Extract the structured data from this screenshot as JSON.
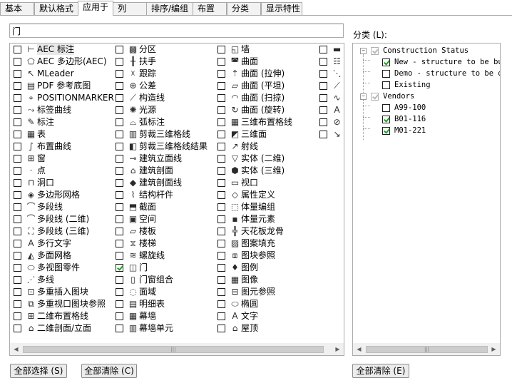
{
  "tabs": [
    "基本",
    "默认格式",
    "应用于",
    "列",
    "排序/编组",
    "布置",
    "分类",
    "显示特性"
  ],
  "active_tab": "应用于",
  "filter": {
    "value": "门"
  },
  "columns": [
    [
      {
        "label": "AEC 标注",
        "icon": "aec-dimension-icon",
        "checked": false,
        "selected": true
      },
      {
        "label": "AEC 多边形(AEC)",
        "icon": "aec-polygon-icon",
        "checked": false
      },
      {
        "label": "MLeader",
        "icon": "mleader-icon",
        "checked": false
      },
      {
        "label": "PDF 参考底图",
        "icon": "pdf-underlay-icon",
        "checked": false
      },
      {
        "label": "POSITIONMARKER",
        "icon": "position-marker-icon",
        "checked": false
      },
      {
        "label": "标签曲线",
        "icon": "tag-curve-icon",
        "checked": false
      },
      {
        "label": "标注",
        "icon": "annotation-icon",
        "checked": false
      },
      {
        "label": "表",
        "icon": "table-icon",
        "checked": false
      },
      {
        "label": "布置曲线",
        "icon": "layout-curve-icon",
        "checked": false
      },
      {
        "label": "窗",
        "icon": "window-icon",
        "checked": false
      },
      {
        "label": "点",
        "icon": "point-icon",
        "checked": false
      },
      {
        "label": "洞口",
        "icon": "opening-icon",
        "checked": false
      },
      {
        "label": "多边形网格",
        "icon": "polyface-mesh-icon",
        "checked": false
      },
      {
        "label": "多段线",
        "icon": "polyline-icon",
        "checked": false
      },
      {
        "label": "多段线 (二维)",
        "icon": "polyline-2d-icon",
        "checked": false
      },
      {
        "label": "多段线 (三维)",
        "icon": "polyline-3d-icon",
        "checked": false
      },
      {
        "label": "多行文字",
        "icon": "mtext-icon",
        "checked": false
      },
      {
        "label": "多面网格",
        "icon": "polygon-mesh-icon",
        "checked": false
      },
      {
        "label": "多视图零件",
        "icon": "multiview-part-icon",
        "checked": false
      },
      {
        "label": "多线",
        "icon": "mline-icon",
        "checked": false
      },
      {
        "label": "多重插入图块",
        "icon": "minsert-block-icon",
        "checked": false
      },
      {
        "label": "多重视口图块参照",
        "icon": "mvblock-ref-icon",
        "checked": false
      },
      {
        "label": "二维布置格线",
        "icon": "layout-grid-2d-icon",
        "checked": false
      },
      {
        "label": "二维剖面/立面",
        "icon": "section-elevation-2d-icon",
        "checked": false
      }
    ],
    [
      {
        "label": "分区",
        "icon": "zone-icon",
        "checked": false
      },
      {
        "label": "扶手",
        "icon": "railing-icon",
        "checked": false
      },
      {
        "label": "跟踪",
        "icon": "trace-icon",
        "checked": false
      },
      {
        "label": "公差",
        "icon": "tolerance-icon",
        "checked": false
      },
      {
        "label": "构造线",
        "icon": "xline-icon",
        "checked": false
      },
      {
        "label": "光源",
        "icon": "light-icon",
        "checked": false
      },
      {
        "label": "弧标注",
        "icon": "arc-dimension-icon",
        "checked": false
      },
      {
        "label": "剪裁三维格线",
        "icon": "clip-3d-grid-icon",
        "checked": false
      },
      {
        "label": "剪裁三维格线结果",
        "icon": "clip-3d-grid-result-icon",
        "checked": false
      },
      {
        "label": "建筑立面线",
        "icon": "building-elevation-line-icon",
        "checked": false
      },
      {
        "label": "建筑剖面",
        "icon": "building-section-icon",
        "checked": false
      },
      {
        "label": "建筑剖面线",
        "icon": "building-section-line-icon",
        "checked": false
      },
      {
        "label": "结构杆件",
        "icon": "structural-member-icon",
        "checked": false
      },
      {
        "label": "截面",
        "icon": "section-icon",
        "checked": false
      },
      {
        "label": "空间",
        "icon": "space-icon",
        "checked": false
      },
      {
        "label": "楼板",
        "icon": "slab-icon",
        "checked": false
      },
      {
        "label": "楼梯",
        "icon": "stair-icon",
        "checked": false
      },
      {
        "label": "螺旋线",
        "icon": "helix-icon",
        "checked": false
      },
      {
        "label": "门",
        "icon": "door-icon",
        "checked": true
      },
      {
        "label": "门窗组合",
        "icon": "door-window-assembly-icon",
        "checked": false
      },
      {
        "label": "面域",
        "icon": "region-icon",
        "checked": false
      },
      {
        "label": "明细表",
        "icon": "schedule-table-icon",
        "checked": false
      },
      {
        "label": "幕墙",
        "icon": "curtain-wall-icon",
        "checked": false
      },
      {
        "label": "幕墙单元",
        "icon": "curtain-wall-unit-icon",
        "checked": false
      }
    ],
    [
      {
        "label": "墙",
        "icon": "wall-icon",
        "checked": false
      },
      {
        "label": "曲面",
        "icon": "surface-icon",
        "checked": false
      },
      {
        "label": "曲面 (拉伸)",
        "icon": "surface-extrude-icon",
        "checked": false
      },
      {
        "label": "曲面 (平坦)",
        "icon": "surface-planar-icon",
        "checked": false
      },
      {
        "label": "曲面 (扫掠)",
        "icon": "surface-sweep-icon",
        "checked": false
      },
      {
        "label": "曲面 (旋转)",
        "icon": "surface-revolve-icon",
        "checked": false
      },
      {
        "label": "三维布置格线",
        "icon": "layout-grid-3d-icon",
        "checked": false
      },
      {
        "label": "三维面",
        "icon": "3d-face-icon",
        "checked": false
      },
      {
        "label": "射线",
        "icon": "ray-icon",
        "checked": false
      },
      {
        "label": "实体 (二维)",
        "icon": "solid-2d-icon",
        "checked": false
      },
      {
        "label": "实体 (三维)",
        "icon": "solid-3d-icon",
        "checked": false
      },
      {
        "label": "视口",
        "icon": "viewport-icon",
        "checked": false
      },
      {
        "label": "属性定义",
        "icon": "attribute-definition-icon",
        "checked": false
      },
      {
        "label": "体量编组",
        "icon": "mass-group-icon",
        "checked": false
      },
      {
        "label": "体量元素",
        "icon": "mass-element-icon",
        "checked": false
      },
      {
        "label": "天花板龙骨",
        "icon": "ceiling-grid-icon",
        "checked": false
      },
      {
        "label": "图案填充",
        "icon": "hatch-icon",
        "checked": false
      },
      {
        "label": "图块参照",
        "icon": "block-reference-icon",
        "checked": false
      },
      {
        "label": "图例",
        "icon": "legend-icon",
        "checked": false
      },
      {
        "label": "图像",
        "icon": "image-icon",
        "checked": false
      },
      {
        "label": "图元参照",
        "icon": "entity-reference-icon",
        "checked": false
      },
      {
        "label": "椭圆",
        "icon": "ellipse-icon",
        "checked": false
      },
      {
        "label": "文字",
        "icon": "text-icon",
        "checked": false
      },
      {
        "label": "屋顶",
        "icon": "roof-icon",
        "checked": false
      }
    ],
    [
      {
        "label": "",
        "icon": "partial-item-icon-1",
        "checked": false
      },
      {
        "label": "",
        "icon": "partial-item-icon-2",
        "checked": false
      },
      {
        "label": "",
        "icon": "partial-item-icon-3",
        "checked": false
      },
      {
        "label": "",
        "icon": "partial-item-icon-4",
        "checked": false
      },
      {
        "label": "",
        "icon": "partial-item-icon-5",
        "checked": false
      },
      {
        "label": "",
        "icon": "partial-item-icon-6",
        "checked": false
      },
      {
        "label": "",
        "icon": "partial-item-icon-7",
        "checked": false
      },
      {
        "label": "",
        "icon": "partial-item-icon-8",
        "checked": false
      }
    ]
  ],
  "category": {
    "label": "分类 (L):",
    "tree": [
      {
        "label": "Construction Status",
        "level": 0,
        "expanded": true,
        "state": "partial"
      },
      {
        "label": "New - structure to be bu",
        "level": 1,
        "state": "checked"
      },
      {
        "label": "Demo - structure to be d",
        "level": 1,
        "state": "unchecked"
      },
      {
        "label": "Existing",
        "level": 1,
        "state": "unchecked"
      },
      {
        "label": "Vendors",
        "level": 0,
        "expanded": true,
        "state": "partial"
      },
      {
        "label": "A99-100",
        "level": 1,
        "state": "unchecked"
      },
      {
        "label": "B01-116",
        "level": 1,
        "state": "checked"
      },
      {
        "label": "M01-221",
        "level": 1,
        "state": "checked"
      }
    ]
  },
  "buttons": {
    "select_all": "全部选择 (S)",
    "clear_all": "全部清除 (C)",
    "clear_all_category": "全部清除 (E)"
  },
  "colors": {
    "check_green": "#21a121",
    "border": "#aaaaaa",
    "tab_bg": "#f2f2f2"
  }
}
